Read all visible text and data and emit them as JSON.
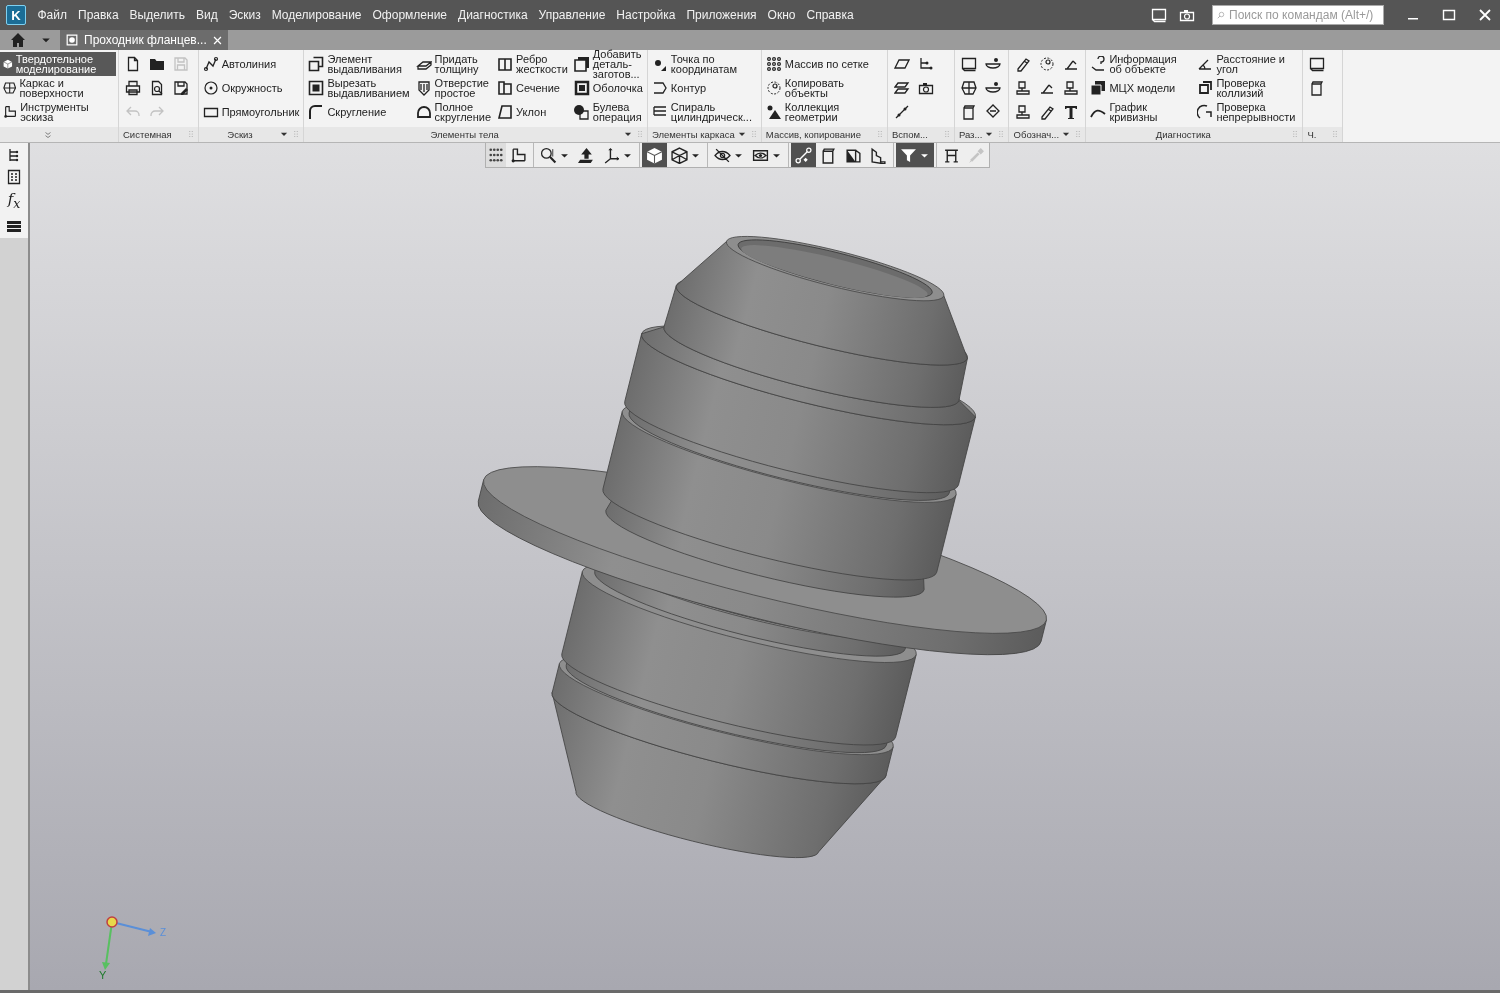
{
  "app": {
    "logo": "K"
  },
  "menu": [
    "Файл",
    "Правка",
    "Выделить",
    "Вид",
    "Эскиз",
    "Моделирование",
    "Оформление",
    "Диагностика",
    "Управление",
    "Настройка",
    "Приложения",
    "Окно",
    "Справка"
  ],
  "search": {
    "placeholder": "Поиск по командам (Alt+/)"
  },
  "document_tabs": [
    {
      "title": "Проходник фланцев...",
      "selected": true
    }
  ],
  "ribbon": {
    "modes": [
      {
        "label": "Твердотельное моделирование",
        "selected": true
      },
      {
        "label": "Каркас и поверхности",
        "selected": false
      },
      {
        "label": "Инструменты эскиза",
        "selected": false
      }
    ],
    "groups": [
      {
        "title": "Системная",
        "menu": false,
        "kind": "icons",
        "items": [
          {
            "disabled": false
          },
          {
            "disabled": false
          },
          {
            "disabled": true
          },
          {
            "disabled": false
          },
          {
            "disabled": false
          },
          {
            "disabled": false
          },
          {
            "disabled": true
          },
          {
            "disabled": true
          }
        ]
      },
      {
        "title": "Эскиз",
        "menu": true,
        "kind": "commands",
        "items": [
          {
            "label": "Автолиния"
          },
          {
            "label": "Окружность"
          },
          {
            "label": "Прямоугольник"
          }
        ]
      },
      {
        "title": "Элементы тела",
        "menu": true,
        "kind": "commands",
        "items": [
          {
            "label": "Элемент выдавливания"
          },
          {
            "label": "Вырезать выдавливанием"
          },
          {
            "label": "Скругление"
          },
          {
            "label": "Придать толщину"
          },
          {
            "label": "Отверстие простое"
          },
          {
            "label": "Полное скругление"
          },
          {
            "label": "Ребро жесткости"
          },
          {
            "label": "Сечение"
          },
          {
            "label": "Уклон"
          },
          {
            "label": "Добавить деталь-заготов..."
          },
          {
            "label": "Оболочка"
          },
          {
            "label": "Булева операция"
          }
        ]
      },
      {
        "title": "Элементы каркаса",
        "menu": true,
        "kind": "commands",
        "items": [
          {
            "label": "Точка по координатам"
          },
          {
            "label": "Контур"
          },
          {
            "label": "Спираль цилиндрическ..."
          }
        ]
      },
      {
        "title": "Массив, копирование",
        "menu": false,
        "kind": "commands",
        "items": [
          {
            "label": "Массив по сетке"
          },
          {
            "label": "Копировать объекты"
          },
          {
            "label": "Коллекция геометрии"
          }
        ]
      },
      {
        "title": "Вспом...",
        "menu": false,
        "kind": "icons",
        "items": [
          {
            "disabled": false
          },
          {
            "disabled": false
          },
          {
            "disabled": false
          },
          {
            "disabled": false
          },
          {
            "disabled": false
          }
        ]
      },
      {
        "title": "Раз...",
        "menu": true,
        "kind": "icons",
        "items": [
          {
            "disabled": false
          },
          {
            "disabled": false
          },
          {
            "disabled": false
          },
          {
            "disabled": false
          },
          {
            "disabled": false
          },
          {
            "disabled": false
          }
        ]
      },
      {
        "title": "Обознач...",
        "menu": true,
        "kind": "icons",
        "items": [
          {
            "disabled": false
          },
          {
            "disabled": false
          },
          {
            "disabled": false
          },
          {
            "disabled": false
          },
          {
            "disabled": false
          },
          {
            "disabled": false
          },
          {
            "disabled": false
          },
          {
            "disabled": false
          },
          {
            "disabled": false
          }
        ]
      },
      {
        "title": "Диагностика",
        "menu": false,
        "kind": "commands",
        "items": [
          {
            "label": "Информация об объекте"
          },
          {
            "label": "МЦХ модели"
          },
          {
            "label": "График кривизны"
          },
          {
            "label": "Расстояние и угол"
          },
          {
            "label": "Проверка коллизий"
          },
          {
            "label": "Проверка непрерывности"
          }
        ]
      },
      {
        "title": "Ч.",
        "menu": false,
        "kind": "icons",
        "items": [
          {
            "disabled": false
          },
          {
            "disabled": false
          }
        ]
      }
    ]
  },
  "left_toolbar": {
    "formula": "f$_{x}$"
  },
  "view_toolbar": [
    {
      "on": false,
      "menu": false,
      "disabled": false
    },
    {
      "on": false,
      "menu": true,
      "disabled": false
    },
    {
      "on": false,
      "menu": false,
      "disabled": false
    },
    {
      "on": false,
      "menu": true,
      "disabled": false
    },
    {
      "on": true,
      "menu": false,
      "disabled": false
    },
    {
      "on": false,
      "menu": true,
      "disabled": false
    },
    {
      "on": false,
      "menu": true,
      "disabled": false
    },
    {
      "on": false,
      "menu": true,
      "disabled": false
    },
    {
      "on": true,
      "menu": false,
      "disabled": false
    },
    {
      "on": false,
      "menu": false,
      "disabled": false
    },
    {
      "on": false,
      "menu": false,
      "disabled": false
    },
    {
      "on": false,
      "menu": false,
      "disabled": false
    },
    {
      "on": true,
      "menu": true,
      "disabled": false
    },
    {
      "on": false,
      "menu": false,
      "disabled": false
    },
    {
      "on": false,
      "menu": false,
      "disabled": true
    }
  ],
  "triad": {
    "labels": [
      "Z",
      "Y"
    ]
  }
}
